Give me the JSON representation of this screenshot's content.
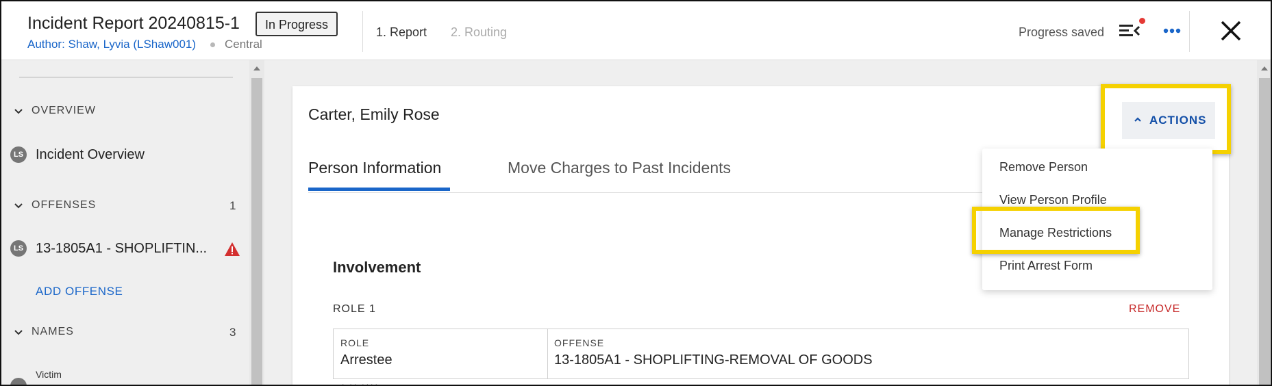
{
  "header": {
    "title": "Incident Report 20240815-1",
    "status": "In Progress",
    "author": "Author: Shaw, Lyvia (LShaw001)",
    "district": "Central",
    "steps": [
      "1. Report",
      "2. Routing"
    ],
    "saved_text": "Progress saved"
  },
  "sidebar": {
    "overview_label": "OVERVIEW",
    "overview_item": "Incident Overview",
    "offenses_label": "OFFENSES",
    "offenses_count": "1",
    "offense_item": "13-1805A1 - SHOPLIFTIN...",
    "add_offense": "ADD OFFENSE",
    "names_label": "NAMES",
    "names_count": "3",
    "victim_label": "Victim",
    "avatar_initials": "LS"
  },
  "main": {
    "person_name": "Carter, Emily Rose",
    "tabs": [
      "Person Information",
      "Move Charges to Past Incidents"
    ],
    "involvement_title": "Involvement",
    "role_label": "ROLE 1",
    "remove_label": "REMOVE",
    "table": {
      "role_header": "ROLE",
      "role_value": "Arrestee",
      "offense_header": "OFFENSE",
      "offense_value": "13-1805A1 - SHOPLIFTING-REMOVAL OF GOODS"
    },
    "cut_text": "* ** ****"
  },
  "actions": {
    "label": "ACTIONS",
    "menu": [
      "Remove Person",
      "View Person Profile",
      "Manage Restrictions",
      "Print Arrest Form"
    ]
  },
  "colors": {
    "accent": "#1a66c9",
    "highlight": "#f5d100",
    "danger": "#c62828"
  }
}
